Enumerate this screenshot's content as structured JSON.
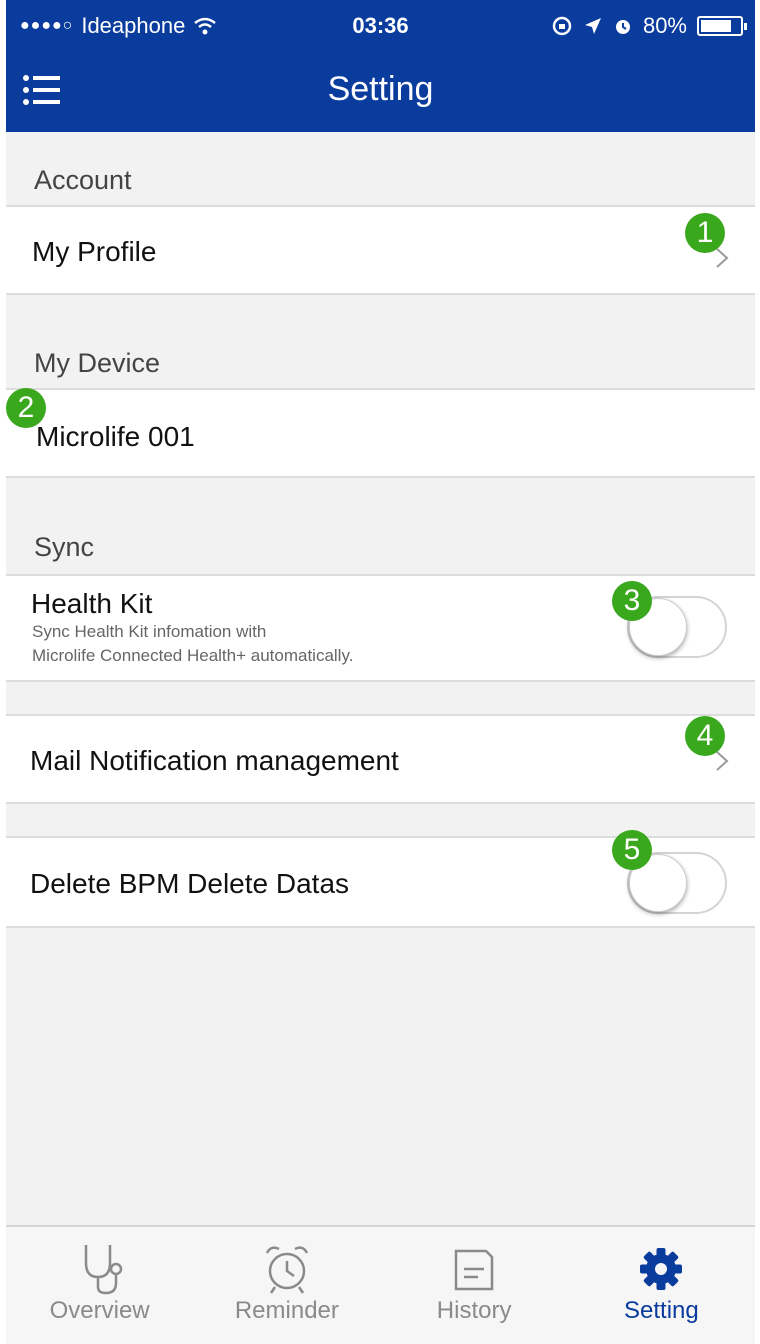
{
  "status_bar": {
    "signal": "●●●●○",
    "carrier": "Ideaphone",
    "time": "03:36",
    "battery": "80%"
  },
  "header": {
    "title": "Setting",
    "menu_icon": "list-menu-icon"
  },
  "sections": {
    "account": {
      "label": "Account",
      "my_profile": {
        "title": "My Profile",
        "badge": "1"
      }
    },
    "device": {
      "label": "My Device",
      "device_name": "Microlife 001",
      "badge": "2"
    },
    "sync": {
      "label": "Sync",
      "health_kit": {
        "title": "Health Kit",
        "sub_line1": "Sync Health Kit infomation with",
        "sub_line2": "Microlife Connected Health+ automatically.",
        "enabled": false,
        "badge": "3"
      }
    },
    "mail": {
      "title": "Mail Notification management",
      "badge": "4"
    },
    "delete": {
      "title": "Delete BPM Delete Datas",
      "enabled": false,
      "badge": "5"
    }
  },
  "tabs": [
    {
      "label": "Overview",
      "icon": "stethoscope-icon",
      "active": false
    },
    {
      "label": "Reminder",
      "icon": "alarm-clock-icon",
      "active": false
    },
    {
      "label": "History",
      "icon": "document-icon",
      "active": false
    },
    {
      "label": "Setting",
      "icon": "gear-icon",
      "active": true
    }
  ],
  "colors": {
    "brand_blue": "#0a3c9e",
    "badge_green": "#3aa81c",
    "inactive_tab": "#8a8a8a"
  }
}
